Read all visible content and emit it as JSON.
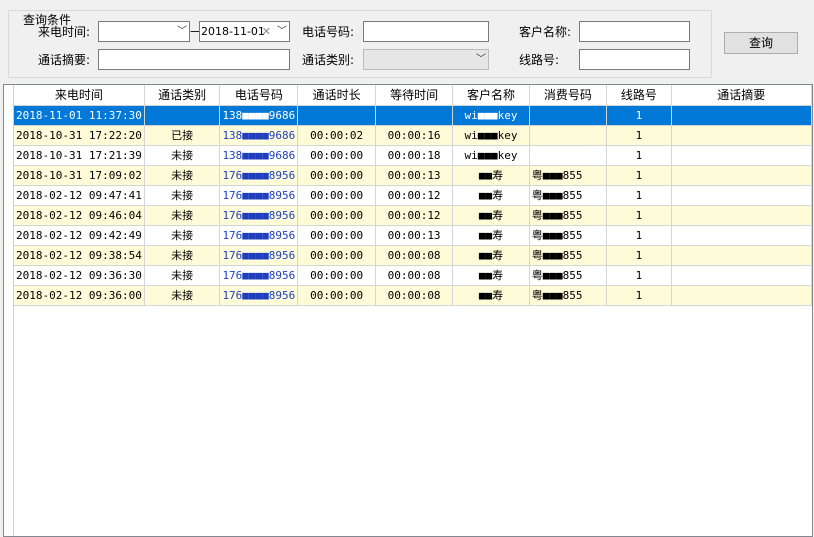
{
  "query": {
    "group_title": "查询条件",
    "labels": {
      "call_time": "来电时间:",
      "phone": "电话号码:",
      "customer": "客户名称:",
      "summary": "通话摘要:",
      "call_type": "通话类别:",
      "line": "线路号:"
    },
    "date_end": "2018-11-01",
    "date_separator": "—",
    "search_button": "查询"
  },
  "grid": {
    "columns": [
      "来电时间",
      "通话类别",
      "电话号码",
      "通话时长",
      "等待时间",
      "客户名称",
      "消费号码",
      "线路号",
      "通话摘要"
    ],
    "rows": [
      {
        "time": "2018-11-01 11:37:30",
        "type": "",
        "phone": "138■■■■9686",
        "duration": "",
        "wait": "",
        "customer": "wi■■■key",
        "account": "",
        "line": "1",
        "summary": ""
      },
      {
        "time": "2018-10-31 17:22:20",
        "type": "已接",
        "phone": "138■■■■9686",
        "duration": "00:00:02",
        "wait": "00:00:16",
        "customer": "wi■■■key",
        "account": "",
        "line": "1",
        "summary": ""
      },
      {
        "time": "2018-10-31 17:21:39",
        "type": "未接",
        "phone": "138■■■■9686",
        "duration": "00:00:00",
        "wait": "00:00:18",
        "customer": "wi■■■key",
        "account": "",
        "line": "1",
        "summary": ""
      },
      {
        "time": "2018-10-31 17:09:02",
        "type": "未接",
        "phone": "176■■■■8956",
        "duration": "00:00:00",
        "wait": "00:00:13",
        "customer": "■■寿",
        "account": "粤■■■855",
        "line": "1",
        "summary": ""
      },
      {
        "time": "2018-02-12 09:47:41",
        "type": "未接",
        "phone": "176■■■■8956",
        "duration": "00:00:00",
        "wait": "00:00:12",
        "customer": "■■寿",
        "account": "粤■■■855",
        "line": "1",
        "summary": ""
      },
      {
        "time": "2018-02-12 09:46:04",
        "type": "未接",
        "phone": "176■■■■8956",
        "duration": "00:00:00",
        "wait": "00:00:12",
        "customer": "■■寿",
        "account": "粤■■■855",
        "line": "1",
        "summary": ""
      },
      {
        "time": "2018-02-12 09:42:49",
        "type": "未接",
        "phone": "176■■■■8956",
        "duration": "00:00:00",
        "wait": "00:00:13",
        "customer": "■■寿",
        "account": "粤■■■855",
        "line": "1",
        "summary": ""
      },
      {
        "time": "2018-02-12 09:38:54",
        "type": "未接",
        "phone": "176■■■■8956",
        "duration": "00:00:00",
        "wait": "00:00:08",
        "customer": "■■寿",
        "account": "粤■■■855",
        "line": "1",
        "summary": ""
      },
      {
        "time": "2018-02-12 09:36:30",
        "type": "未接",
        "phone": "176■■■■8956",
        "duration": "00:00:00",
        "wait": "00:00:08",
        "customer": "■■寿",
        "account": "粤■■■855",
        "line": "1",
        "summary": ""
      },
      {
        "time": "2018-02-12 09:36:00",
        "type": "未接",
        "phone": "176■■■■8956",
        "duration": "00:00:00",
        "wait": "00:00:08",
        "customer": "■■寿",
        "account": "粤■■■855",
        "line": "1",
        "summary": ""
      }
    ]
  }
}
